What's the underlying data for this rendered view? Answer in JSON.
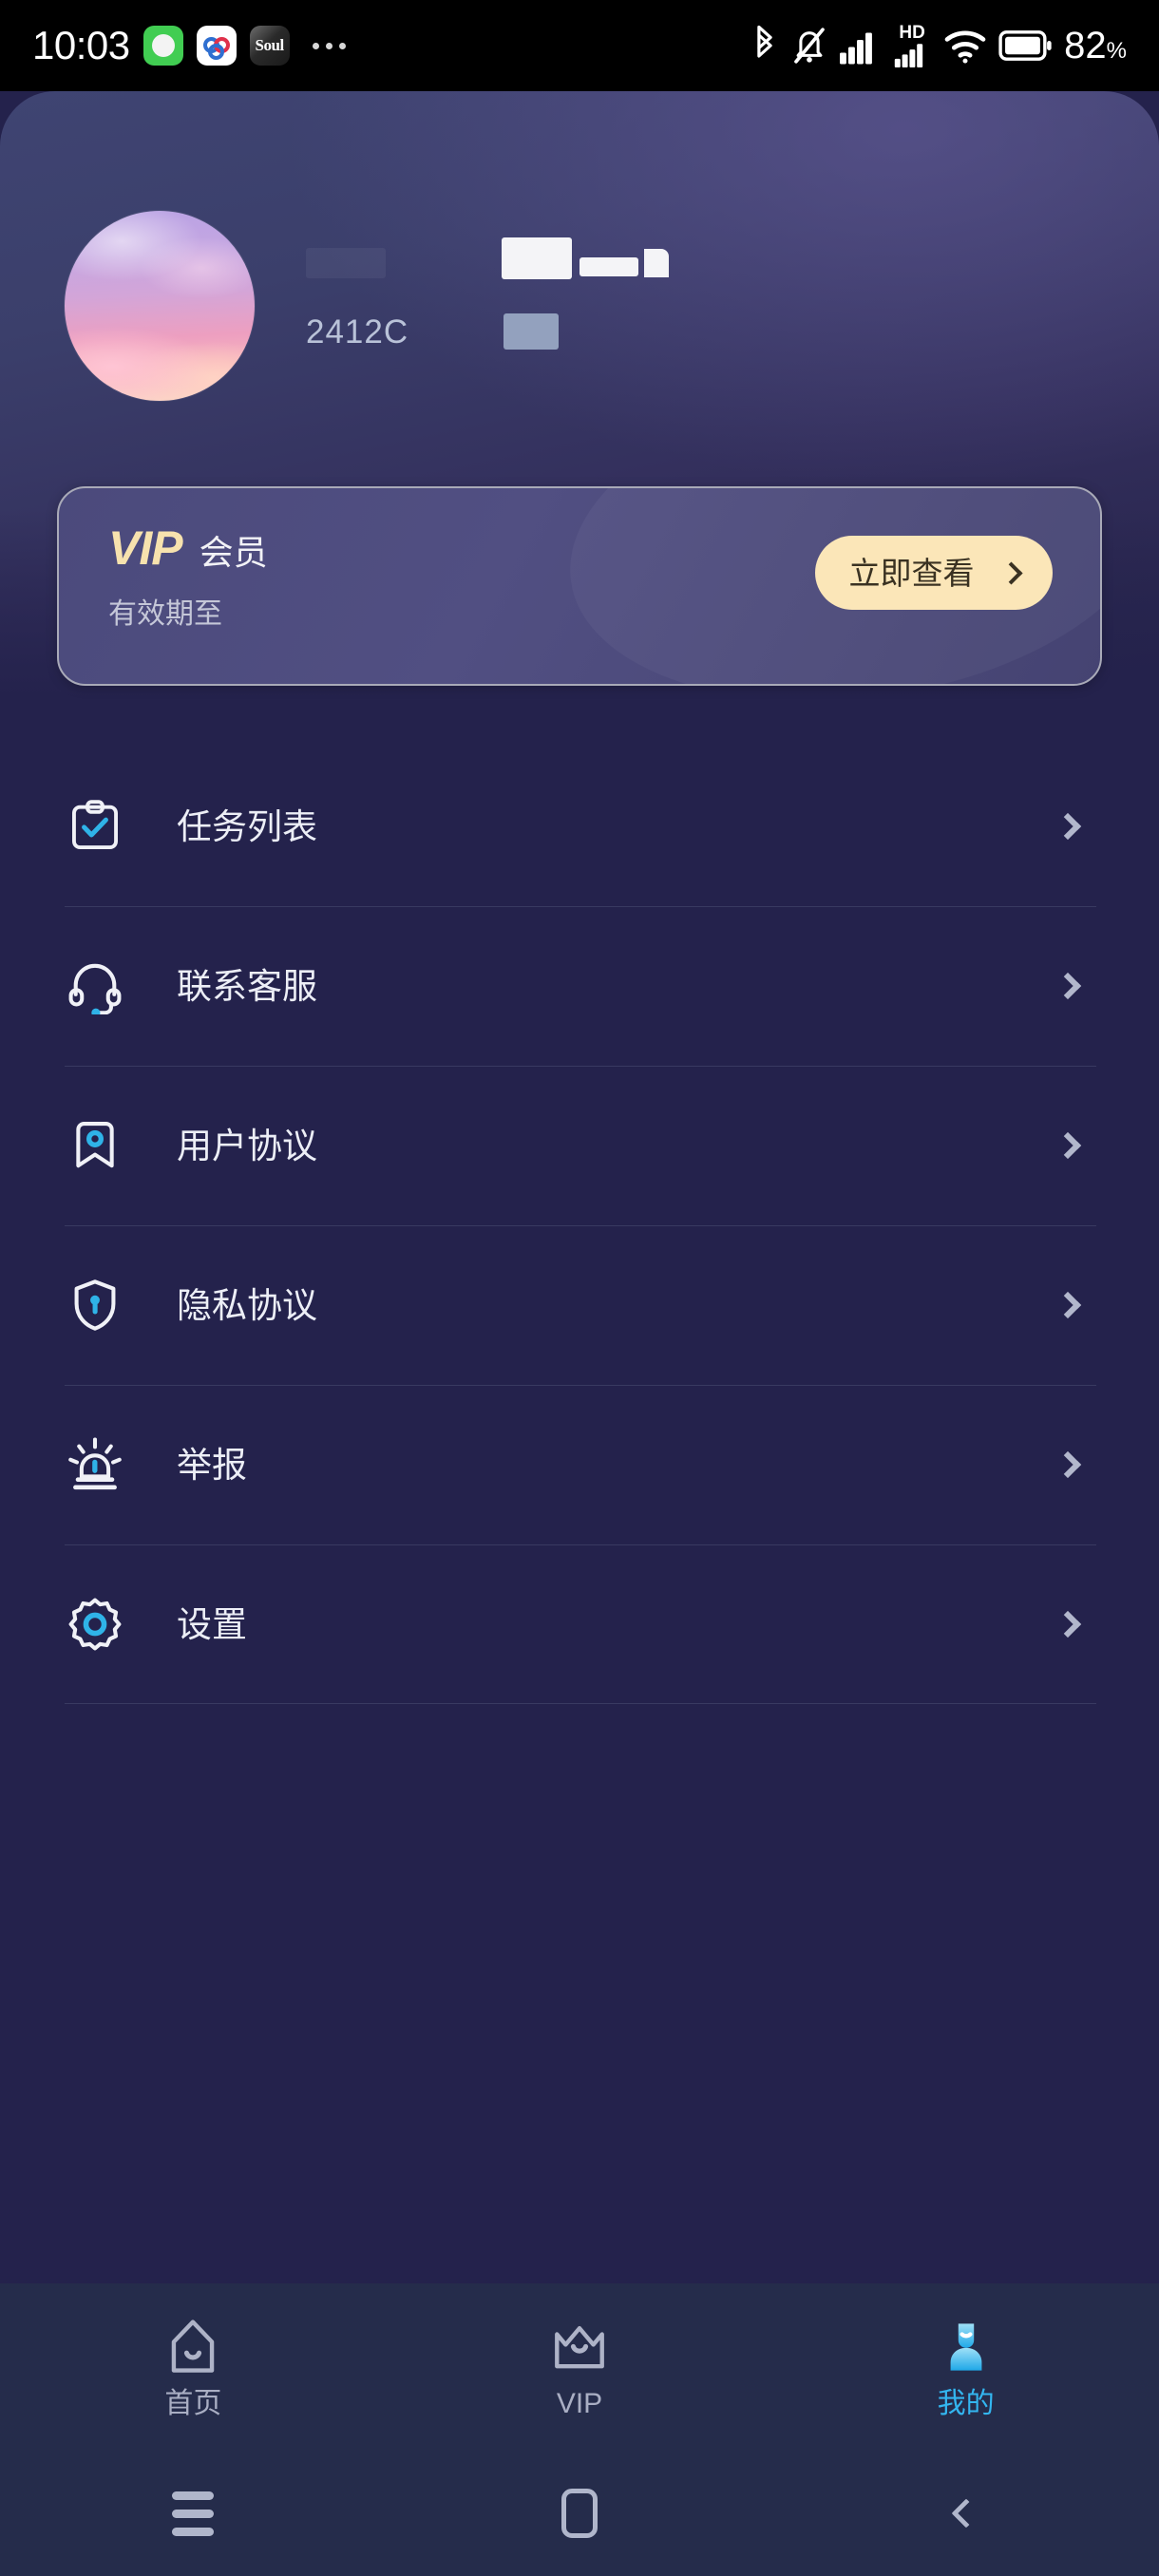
{
  "status_bar": {
    "time": "10:03",
    "app_icons": [
      "messages-green-icon",
      "cloud-blue-icon",
      "soul-app-icon"
    ],
    "soul_label": "Soul",
    "overflow": "…",
    "right_icons": [
      "bluetooth-icon",
      "ringer-muted-icon",
      "signal-bars-icon",
      "hd-icon",
      "signal-bars-2-icon",
      "wifi-icon",
      "battery-icon"
    ],
    "hd_label": "HD",
    "battery_percent": "82",
    "battery_unit": "%"
  },
  "profile": {
    "avatar": "user-avatar-sunset-sky",
    "nickname_redacted": "",
    "uid": "2412C",
    "badge_redacted": ""
  },
  "vip_card": {
    "logo": "VIP",
    "member_label": "会员",
    "expire_label": "有效期至",
    "button_label": "立即查看",
    "button_arrow_icon": "chevron-right-icon",
    "accent_color": "#f7e2ae",
    "button_bg": "#fbe6b8",
    "card_bg": "#4b4a7c"
  },
  "menu": {
    "items": [
      {
        "id": "task-list",
        "label": "任务列表",
        "icon": "clipboard-check-icon"
      },
      {
        "id": "contact-support",
        "label": "联系客服",
        "icon": "headset-icon"
      },
      {
        "id": "user-agreement",
        "label": "用户协议",
        "icon": "bookmark-icon"
      },
      {
        "id": "privacy-policy",
        "label": "隐私协议",
        "icon": "shield-lock-icon"
      },
      {
        "id": "report",
        "label": "举报",
        "icon": "siren-alarm-icon"
      },
      {
        "id": "settings",
        "label": "设置",
        "icon": "gear-icon"
      }
    ],
    "arrow_icon": "chevron-right-icon"
  },
  "tab_bar": {
    "items": [
      {
        "id": "home",
        "label": "首页",
        "icon": "home-icon",
        "active": false
      },
      {
        "id": "vip",
        "label": "VIP",
        "icon": "crown-icon",
        "active": false
      },
      {
        "id": "profile",
        "label": "我的",
        "icon": "person-icon",
        "active": true
      }
    ],
    "active_color": "#33b6f0",
    "inactive_color": "#a9aec3"
  },
  "system_nav": {
    "recents": "recents-icon",
    "home": "home-square-icon",
    "back": "back-chevron-icon"
  },
  "theme": {
    "page_bg": "#24224c",
    "header_top": "#3f4472",
    "tabbar_bg": "#252c4b",
    "divider": "#393a61",
    "accent_cyan": "#2fb3e8"
  }
}
